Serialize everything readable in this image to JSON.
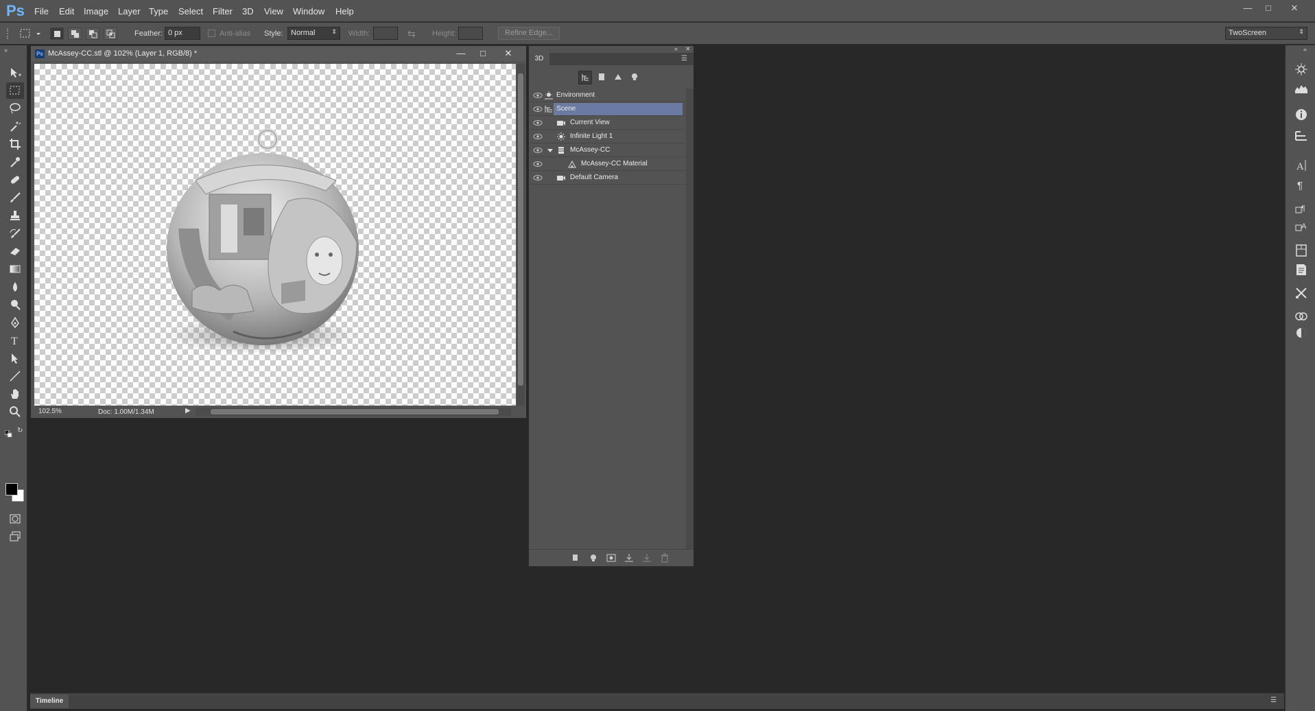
{
  "app": {
    "logo": "Ps"
  },
  "menu": [
    "File",
    "Edit",
    "Image",
    "Layer",
    "Type",
    "Select",
    "Filter",
    "3D",
    "View",
    "Window",
    "Help"
  ],
  "options_bar": {
    "feather_label": "Feather:",
    "feather_value": "0 px",
    "antialias_label": "Anti-alias",
    "style_label": "Style:",
    "style_value": "Normal",
    "width_label": "Width:",
    "height_label": "Height:",
    "refine_edge_label": "Refine Edge...",
    "workspace_value": "TwoScreen"
  },
  "document": {
    "title": "McAssey-CC.stl @ 102% (Layer 1, RGB/8) *",
    "zoom": "102.5%",
    "doc_info": "Doc: 1.00M/1.34M"
  },
  "panel_3d": {
    "tab_label": "3D",
    "items": [
      {
        "label": "Environment",
        "icon": "environment-icon"
      },
      {
        "label": "Scene",
        "icon": "scene-icon",
        "selected": true
      },
      {
        "label": "Current View",
        "icon": "camera-icon"
      },
      {
        "label": "Infinite Light 1",
        "icon": "light-icon"
      },
      {
        "label": "McAssey-CC",
        "icon": "mesh-icon",
        "expanded": true
      },
      {
        "label": "McAssey-CC Material",
        "icon": "material-icon"
      },
      {
        "label": "Default Camera",
        "icon": "camera-icon"
      }
    ]
  },
  "timeline": {
    "label": "Timeline"
  },
  "colors": {
    "accent": "#6fb6ff",
    "selection": "#6a7aa0",
    "ui_bg": "#535353",
    "workspace_bg": "#282828"
  }
}
